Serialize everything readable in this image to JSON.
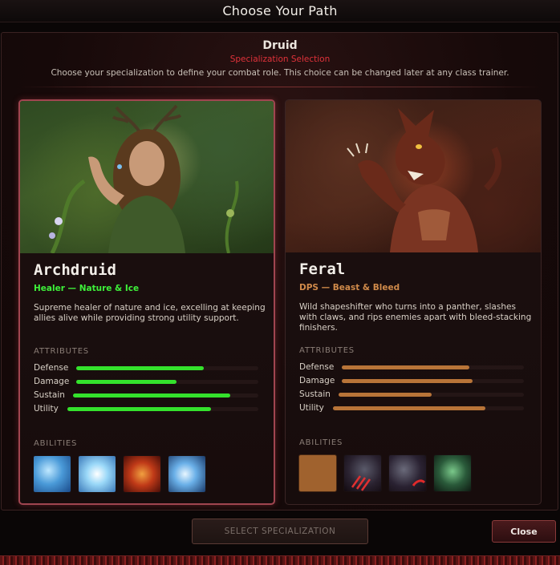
{
  "window": {
    "title": "Choose Your Path"
  },
  "header": {
    "class_name": "Druid",
    "subtitle": "Specialization Selection",
    "description": "Choose your specialization to define your combat role. This choice can be changed later at any class trainer."
  },
  "specs": [
    {
      "name": "Archdruid",
      "role": "Healer — Nature & Ice",
      "role_color": "#3ef03a",
      "description": "Supreme healer of nature and ice, excelling at keeping allies alive while providing strong utility support.",
      "attributes_label": "ATTRIBUTES",
      "bar_color": "#34e22c",
      "attributes": [
        {
          "label": "Defense",
          "value": 0.7
        },
        {
          "label": "Damage",
          "value": 0.55
        },
        {
          "label": "Sustain",
          "value": 0.85
        },
        {
          "label": "Utility",
          "value": 0.75
        }
      ],
      "abilities_label": "ABILITIES",
      "abilities": [
        "ice-wave-icon",
        "frost-burst-icon",
        "nature-dragon-icon",
        "ice-shard-icon"
      ],
      "selected": true
    },
    {
      "name": "Feral",
      "role": "DPS — Beast & Bleed",
      "role_color": "#d08a4a",
      "description": "Wild shapeshifter who turns into a panther, slashes with claws, and rips enemies apart with bleed-stacking finishers.",
      "attributes_label": "ATTRIBUTES",
      "bar_color": "#b87438",
      "attributes": [
        {
          "label": "Defense",
          "value": 0.7
        },
        {
          "label": "Damage",
          "value": 0.72
        },
        {
          "label": "Sustain",
          "value": 0.5
        },
        {
          "label": "Utility",
          "value": 0.8
        }
      ],
      "abilities_label": "ABILITIES",
      "abilities": [
        "empty-slot-icon",
        "panther-claw-icon",
        "panther-pounce-icon",
        "spirit-panther-icon"
      ],
      "selected": false
    }
  ],
  "footer": {
    "select_label": "SELECT SPECIALIZATION",
    "close_label": "Close"
  }
}
